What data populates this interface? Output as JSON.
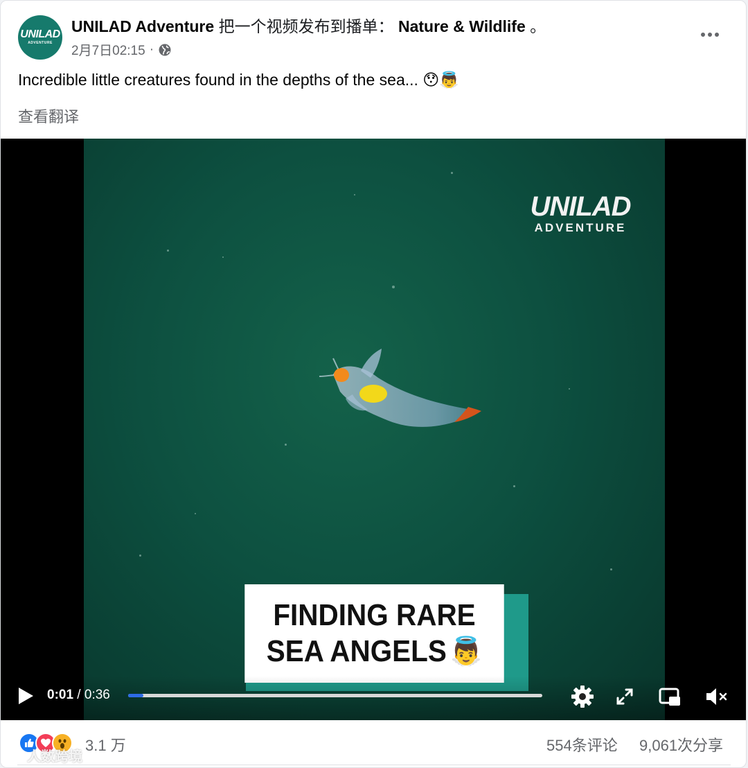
{
  "post": {
    "page_name": "UNILAD Adventure",
    "action_text": "把一个视频发布到播单：",
    "playlist": "Nature & Wildlife",
    "period": "。",
    "timestamp": "2月7日02:15",
    "separator": "·",
    "privacy_icon": "globe-icon",
    "avatar_text_main": "UNILAD",
    "avatar_text_sub": "ADVENTURE",
    "text": "Incredible little creatures found in the depths of the sea... 😯👼",
    "translate_label": "查看翻译"
  },
  "video": {
    "brand_main": "UNILAD",
    "brand_sub": "ADVENTURE",
    "caption_line1": "FINDING RARE",
    "caption_line2": "SEA ANGELS",
    "caption_emoji": "👼",
    "current_time": "0:01",
    "time_separator": " / ",
    "duration": "0:36",
    "progress": 0.036,
    "colors": {
      "frame": "#0d5040",
      "progress_fill": "#2d6be6",
      "caption_shadow": "#1f9a8a"
    }
  },
  "footer": {
    "reaction_icons": [
      "like-icon",
      "love-icon",
      "wow-icon"
    ],
    "reaction_count": "3.1 万",
    "comments": "554条评论",
    "shares": "9,061次分享",
    "watermark": "人数跨境"
  }
}
